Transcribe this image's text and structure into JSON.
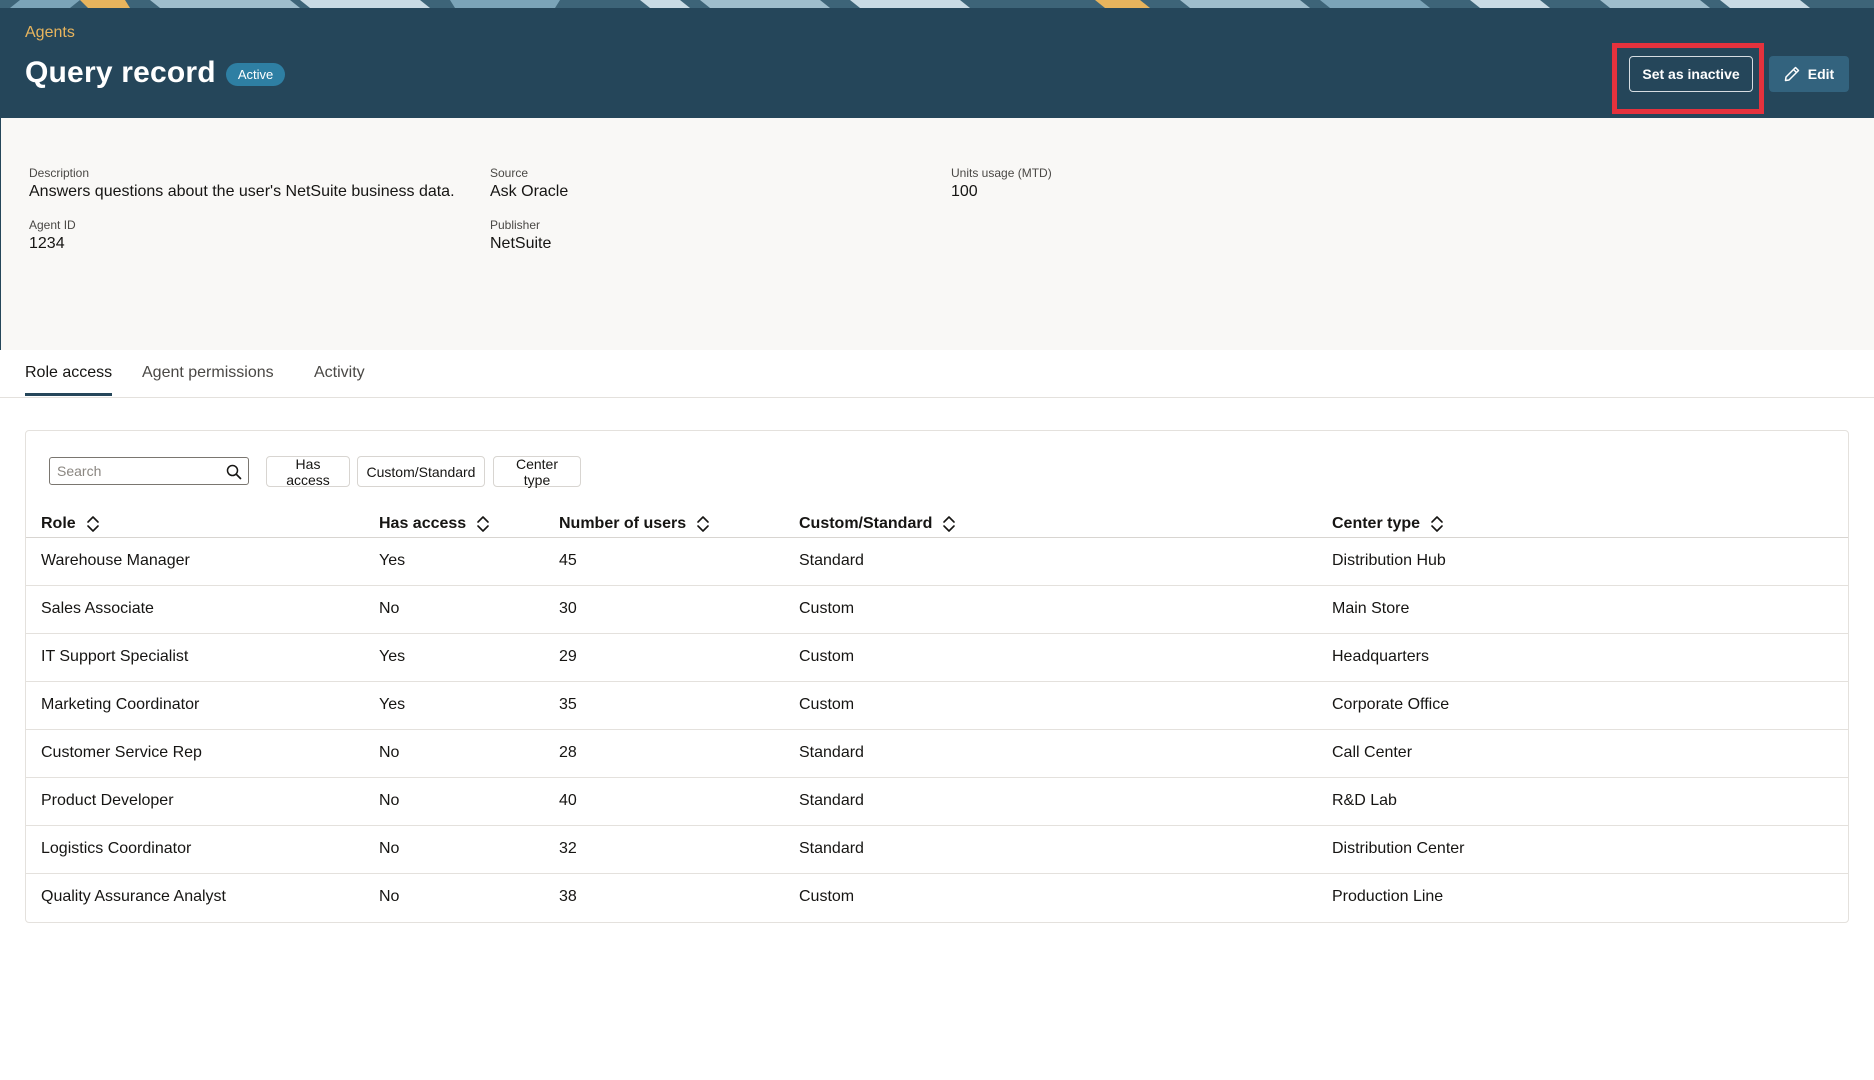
{
  "header": {
    "breadcrumb": "Agents",
    "title": "Query record",
    "status": "Active",
    "set_inactive_label": "Set as inactive",
    "edit_label": "Edit",
    "edit_icon": "pencil-icon"
  },
  "details": {
    "description": {
      "label": "Description",
      "value": "Answers questions about the user's NetSuite business data."
    },
    "agent_id": {
      "label": "Agent ID",
      "value": "1234"
    },
    "source": {
      "label": "Source",
      "value": "Ask Oracle"
    },
    "publisher": {
      "label": "Publisher",
      "value": "NetSuite"
    },
    "units_usage": {
      "label": "Units usage (MTD)",
      "value": "100"
    }
  },
  "tabs": [
    {
      "label": "Role access",
      "active": true
    },
    {
      "label": "Agent permissions",
      "active": false
    },
    {
      "label": "Activity",
      "active": false
    }
  ],
  "toolbar": {
    "search_placeholder": "Search",
    "search_icon": "search-icon",
    "filters": [
      "Has access",
      "Custom/Standard",
      "Center type"
    ]
  },
  "table": {
    "columns": [
      "Role",
      "Has access",
      "Number of users",
      "Custom/Standard",
      "Center type"
    ],
    "rows": [
      [
        "Warehouse Manager",
        "Yes",
        "45",
        "Standard",
        "Distribution Hub"
      ],
      [
        "Sales Associate",
        "No",
        "30",
        "Custom",
        "Main Store"
      ],
      [
        "IT Support Specialist",
        "Yes",
        "29",
        "Custom",
        "Headquarters"
      ],
      [
        "Marketing Coordinator",
        "Yes",
        "35",
        "Custom",
        "Corporate Office"
      ],
      [
        "Customer Service Rep",
        "No",
        "28",
        "Standard",
        "Call Center"
      ],
      [
        "Product Developer",
        "No",
        "40",
        "Standard",
        "R&D Lab"
      ],
      [
        "Logistics Coordinator",
        "No",
        "32",
        "Standard",
        "Distribution Center"
      ],
      [
        "Quality Assurance Analyst",
        "No",
        "38",
        "Custom",
        "Production Line"
      ]
    ]
  },
  "colors": {
    "header_bg": "#25465a",
    "breadcrumb": "#e7b45d",
    "badge": "#2e7fa3",
    "highlight": "#e5323d",
    "edit_button": "#33637e"
  }
}
